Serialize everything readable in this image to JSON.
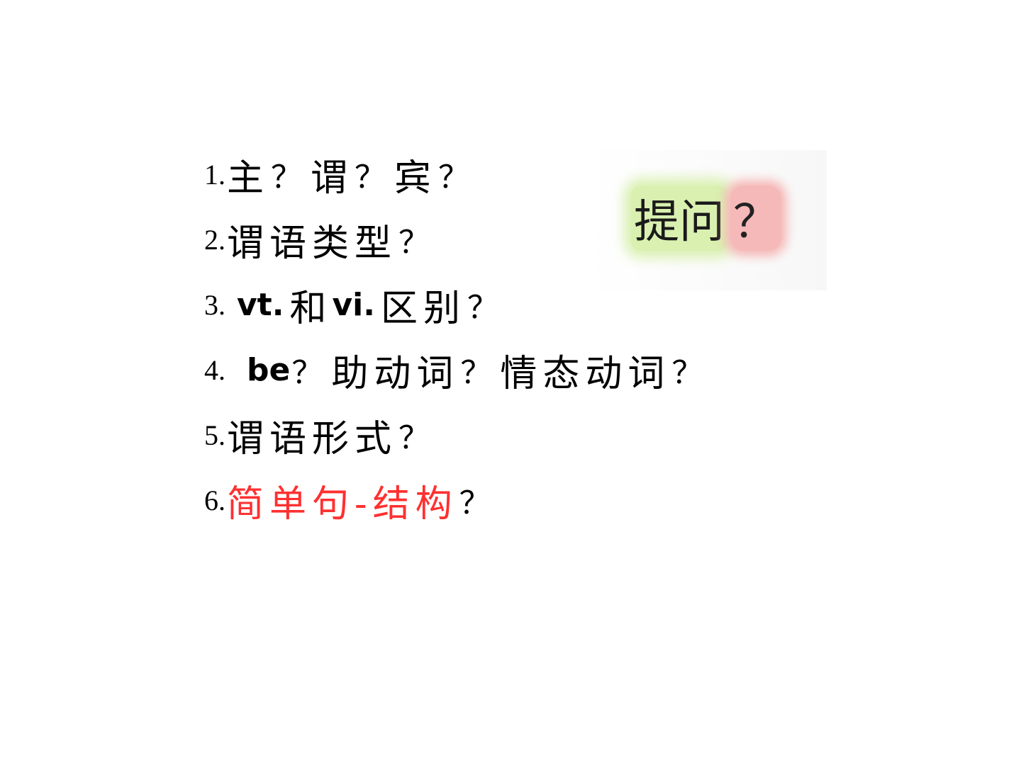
{
  "items": [
    {
      "num": "1.",
      "parts": [
        "主",
        "？",
        "谓",
        "？",
        "宾",
        "？"
      ]
    },
    {
      "num": "2.",
      "text": "谓语类型",
      "q": "？"
    },
    {
      "num": "3.",
      "en1": "vt.",
      "cn1": "和",
      "en2": "vi.",
      "cn2": "区别",
      "q": "？"
    },
    {
      "num": "4.",
      "en": "be",
      "q1": "？",
      "cn1": "助动词",
      "q2": "？",
      "cn2": "情态动词",
      "q3": "？"
    },
    {
      "num": "5.",
      "text": "谓语形式",
      "q": "？"
    },
    {
      "num": "6.",
      "highlight": "简单句-结构",
      "q": "？",
      "highlight_color": "#ff3030"
    }
  ],
  "side_label": {
    "word": "提问",
    "mark": "？",
    "word_bg": "#d9f0b0",
    "mark_bg": "#f6b9b9"
  }
}
